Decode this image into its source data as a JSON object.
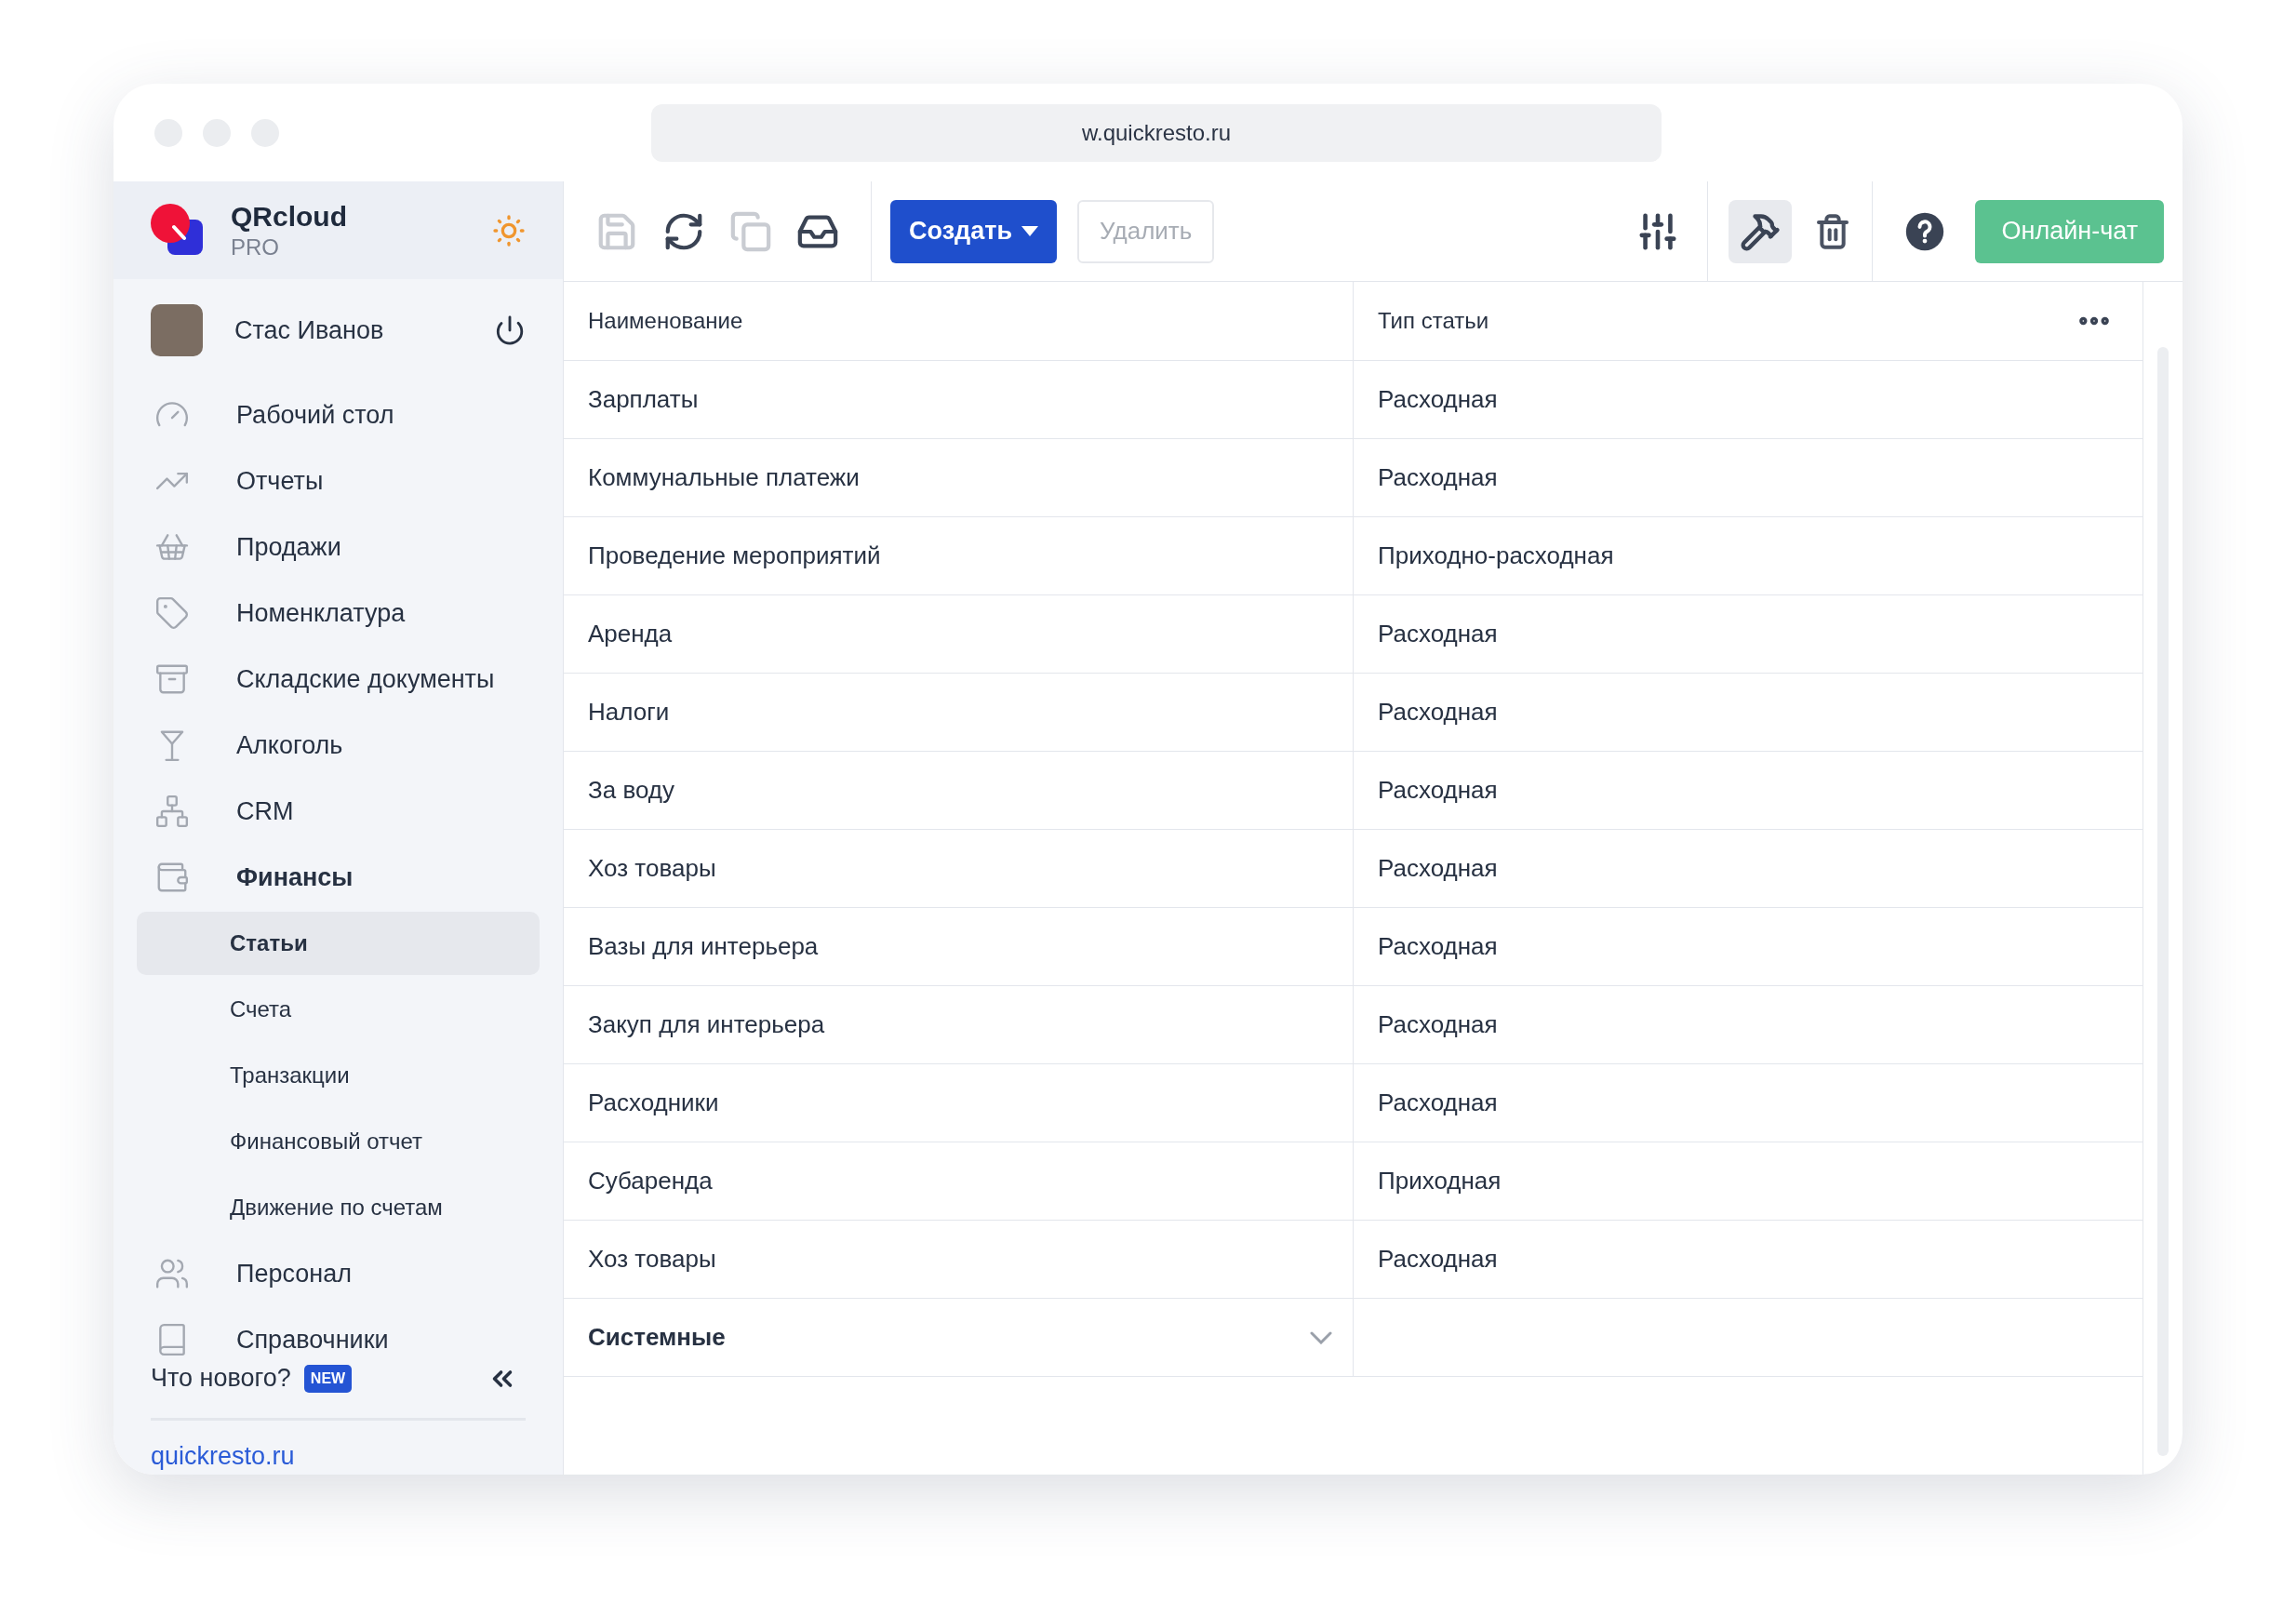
{
  "browser": {
    "url": "w.quickresto.ru"
  },
  "brand": {
    "name": "QRcloud",
    "plan": "PRO"
  },
  "user": {
    "name": "Стас Иванов"
  },
  "nav": [
    {
      "label": "Рабочий стол",
      "expanded": false
    },
    {
      "label": "Отчеты",
      "expanded": false
    },
    {
      "label": "Продажи",
      "expanded": false
    },
    {
      "label": "Номенклатура",
      "expanded": false
    },
    {
      "label": "Складские документы",
      "expanded": false
    },
    {
      "label": "Алкоголь",
      "expanded": false
    },
    {
      "label": "CRM",
      "expanded": false
    },
    {
      "label": "Финансы",
      "expanded": true,
      "children": [
        {
          "label": "Статьи",
          "selected": true
        },
        {
          "label": "Счета",
          "selected": false
        },
        {
          "label": "Транзакции",
          "selected": false
        },
        {
          "label": "Финансовый отчет",
          "selected": false
        },
        {
          "label": "Движение по счетам",
          "selected": false
        }
      ]
    },
    {
      "label": "Персонал",
      "expanded": false
    },
    {
      "label": "Справочники",
      "expanded": false
    }
  ],
  "whats_new": {
    "label": "Что нового?",
    "badge": "NEW"
  },
  "footer_link": "quickresto.ru",
  "toolbar": {
    "icon_buttons": [
      {
        "kind": "save",
        "disabled": true
      },
      {
        "kind": "refresh",
        "disabled": false
      },
      {
        "kind": "copy",
        "disabled": true
      },
      {
        "kind": "inbox",
        "disabled": false
      }
    ],
    "create": "Создать",
    "delete": {
      "label": "Удалить",
      "disabled": true
    },
    "tools_selected": true,
    "chat": "Онлайн-чат"
  },
  "table": {
    "columns": [
      "Наименование",
      "Тип статьи"
    ],
    "rows": [
      {
        "kind": "item",
        "name": "Зарплаты",
        "type": "Расходная"
      },
      {
        "kind": "item",
        "name": "Коммунальные платежи",
        "type": "Расходная"
      },
      {
        "kind": "item",
        "name": "Проведение мероприятий",
        "type": "Приходно-расходная"
      },
      {
        "kind": "item",
        "name": "Аренда",
        "type": "Расходная"
      },
      {
        "kind": "item",
        "name": "Налоги",
        "type": "Расходная"
      },
      {
        "kind": "item",
        "name": "За воду",
        "type": "Расходная"
      },
      {
        "kind": "item",
        "name": "Хоз товары",
        "type": "Расходная"
      },
      {
        "kind": "item",
        "name": "Вазы для интерьера",
        "type": "Расходная"
      },
      {
        "kind": "item",
        "name": "Закуп для интерьера",
        "type": "Расходная"
      },
      {
        "kind": "item",
        "name": "Расходники",
        "type": "Расходная"
      },
      {
        "kind": "item",
        "name": "Субаренда",
        "type": "Приходная"
      },
      {
        "kind": "item",
        "name": "Хоз товары",
        "type": "Расходная"
      },
      {
        "kind": "group",
        "name": "Системные",
        "expanded": false
      }
    ]
  }
}
